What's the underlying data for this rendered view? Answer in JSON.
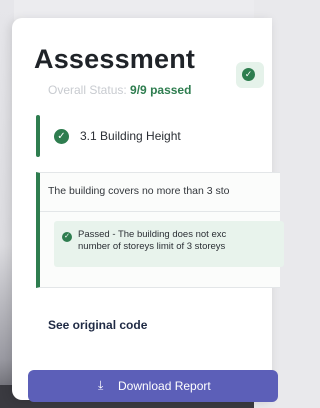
{
  "panel": {
    "title": "Assessment",
    "overall_status_label": "Overall Status:",
    "overall_status_value": "9/9 passed"
  },
  "section": {
    "label": "3.1 Building Height"
  },
  "result": {
    "description": "The building covers no more than 3 sto",
    "passed_text": "Passed - The building does not exc\nnumber of storeys limit of 3 storeys"
  },
  "links": {
    "see_original_code": "See original code"
  },
  "actions": {
    "download_label": "Download Report"
  },
  "colors": {
    "accent_green": "#2e7d4f",
    "button_primary": "#5c5fb8"
  },
  "icons": {
    "status": "check-circle-icon",
    "download": "download-icon"
  }
}
